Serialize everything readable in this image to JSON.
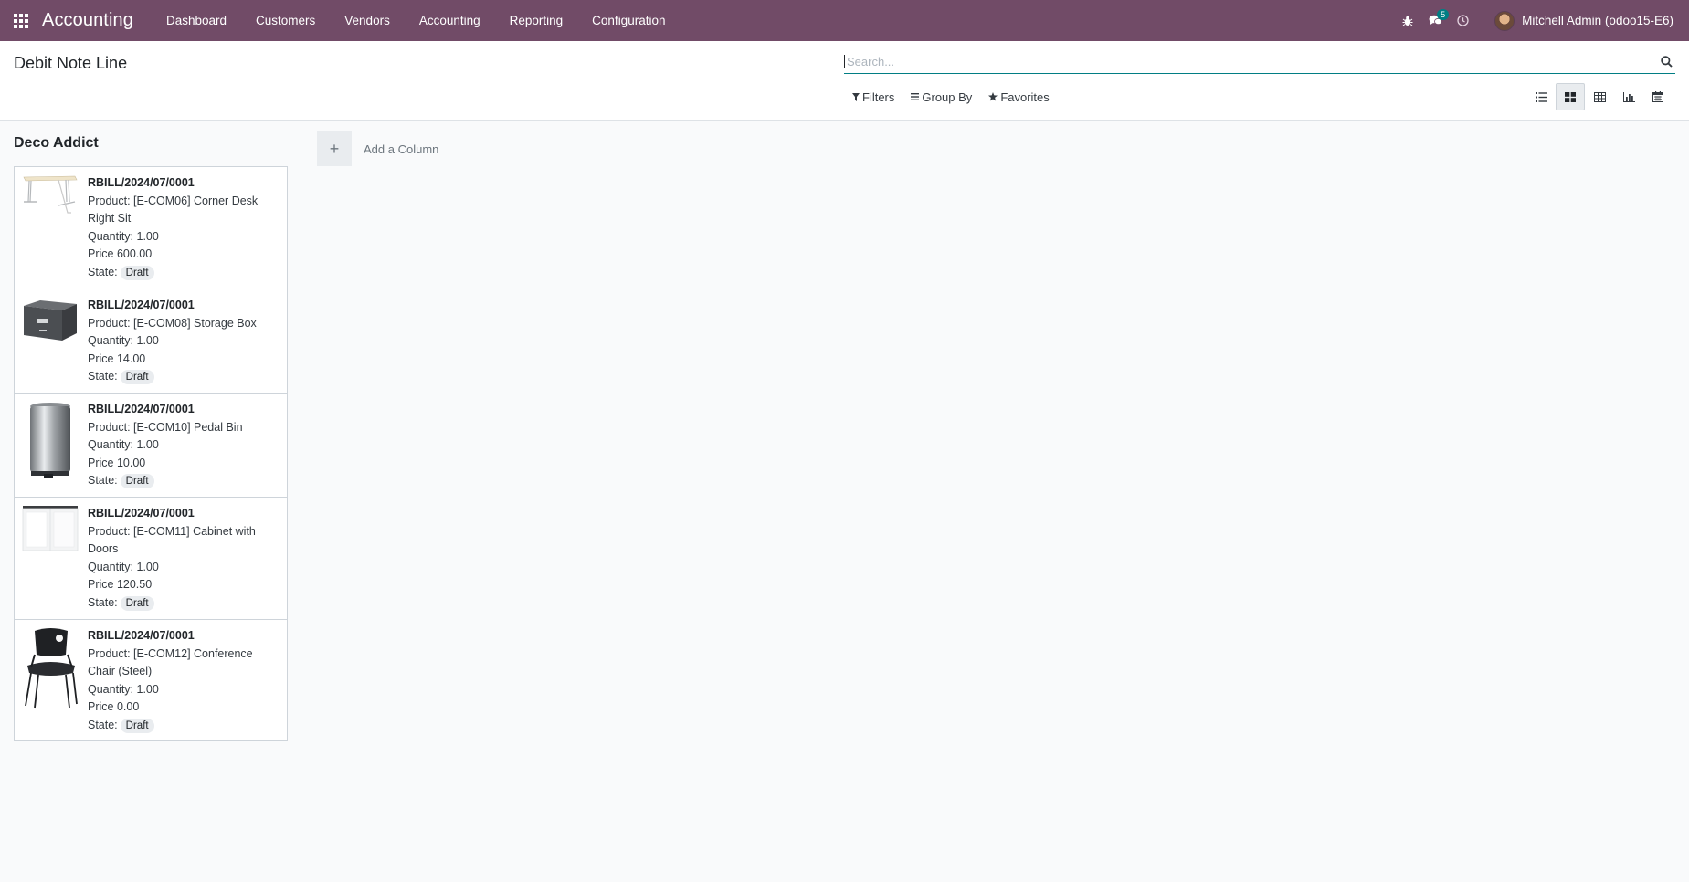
{
  "navbar": {
    "brand": "Accounting",
    "menu": [
      "Dashboard",
      "Customers",
      "Vendors",
      "Accounting",
      "Reporting",
      "Configuration"
    ],
    "message_count": "5",
    "user": "Mitchell Admin (odoo15-E6)"
  },
  "control_panel": {
    "title": "Debit Note Line",
    "search_placeholder": "Search...",
    "filters_label": "Filters",
    "group_by_label": "Group By",
    "favorites_label": "Favorites"
  },
  "kanban": {
    "column_title": "Deco Addict",
    "add_column_label": "Add a Column",
    "cards": [
      {
        "ref": "RBILL/2024/07/0001",
        "product": "Product: [E-COM06] Corner Desk Right Sit",
        "quantity": "Quantity: 1.00",
        "price": "Price 600.00",
        "state_label": "State:",
        "state": "Draft",
        "image": "desk"
      },
      {
        "ref": "RBILL/2024/07/0001",
        "product": "Product: [E-COM08] Storage Box",
        "quantity": "Quantity: 1.00",
        "price": "Price 14.00",
        "state_label": "State:",
        "state": "Draft",
        "image": "box"
      },
      {
        "ref": "RBILL/2024/07/0001",
        "product": "Product: [E-COM10] Pedal Bin",
        "quantity": "Quantity: 1.00",
        "price": "Price 10.00",
        "state_label": "State:",
        "state": "Draft",
        "image": "bin"
      },
      {
        "ref": "RBILL/2024/07/0001",
        "product": "Product: [E-COM11] Cabinet with Doors",
        "quantity": "Quantity: 1.00",
        "price": "Price 120.50",
        "state_label": "State:",
        "state": "Draft",
        "image": "cabinet"
      },
      {
        "ref": "RBILL/2024/07/0001",
        "product": "Product: [E-COM12] Conference Chair (Steel)",
        "quantity": "Quantity: 1.00",
        "price": "Price 0.00",
        "state_label": "State:",
        "state": "Draft",
        "image": "chair"
      }
    ]
  }
}
